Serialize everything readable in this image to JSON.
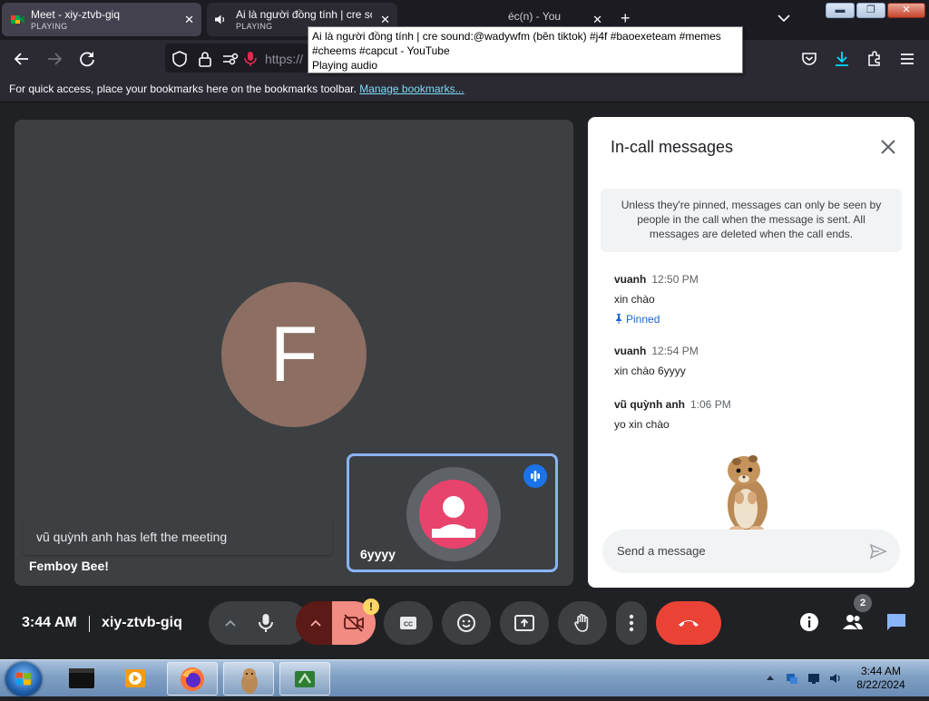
{
  "browser": {
    "tabs": [
      {
        "title": "Meet - xiy-ztvb-giq",
        "status": "PLAYING"
      },
      {
        "title": "Ai là người đồng tính | cre sou",
        "status": "PLAYING"
      },
      {
        "title": "éc(n) - You"
      }
    ],
    "tooltip": {
      "line1": "Ai là người đồng tính | cre sound:@wadywfm (bên tiktok) #j4f #baoexeteam #memes",
      "line2": "#cheems #capcut - YouTube",
      "line3": "Playing audio"
    },
    "url_partial": "https://",
    "bookmarks_text": "For quick access, place your bookmarks here on the bookmarks toolbar.",
    "bookmarks_link": "Manage bookmarks..."
  },
  "meet": {
    "main_tile": {
      "initial": "F",
      "name": "Femboy Bee!",
      "toast": "vũ quỳnh anh has left the meeting"
    },
    "self_tile": {
      "name": "6yyyy"
    },
    "time": "3:44 AM",
    "meeting_code": "xiy-ztvb-giq",
    "warning_badge": "!",
    "people_count": "2"
  },
  "chat": {
    "title": "In-call messages",
    "notice": "Unless they're pinned, messages can only be seen by people in the call when the message is sent. All messages are deleted when the call ends.",
    "messages": [
      {
        "sender": "vuanh",
        "time": "12:50 PM",
        "text": "xin chào",
        "pinned_label": "Pinned"
      },
      {
        "sender": "vuanh",
        "time": "12:54 PM",
        "text": "xin chào 6yyyy"
      },
      {
        "sender": "vũ quỳnh anh",
        "time": "1:06 PM",
        "text": "yo xin chào"
      }
    ],
    "input_placeholder": "Send a message"
  },
  "taskbar": {
    "clock_time": "3:44 AM",
    "clock_date": "8/22/2024"
  },
  "colors": {
    "accent": "#1a73e8",
    "hangup": "#ea4335",
    "panel": "#ffffff",
    "meet_bg": "#202124"
  }
}
